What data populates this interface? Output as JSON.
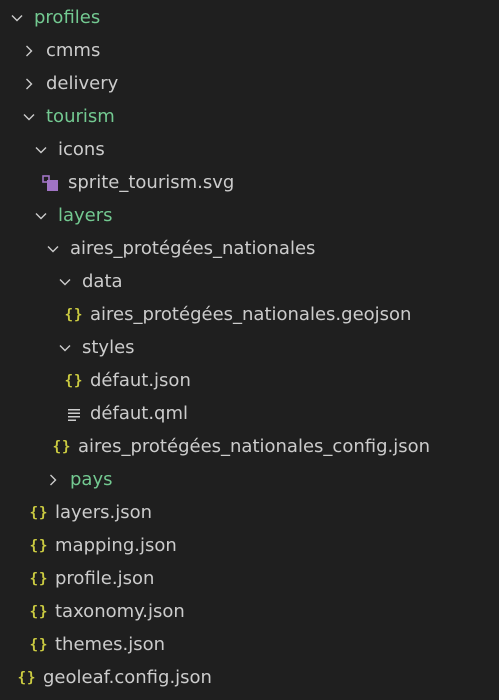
{
  "explorer": {
    "items": [
      {
        "label": "profiles",
        "kind": "folder-open",
        "modified": true
      },
      {
        "label": "cmms",
        "kind": "folder-closed",
        "modified": false
      },
      {
        "label": "delivery",
        "kind": "folder-closed",
        "modified": false
      },
      {
        "label": "tourism",
        "kind": "folder-open",
        "modified": true
      },
      {
        "label": "icons",
        "kind": "folder-open",
        "modified": false
      },
      {
        "label": "sprite_tourism.svg",
        "kind": "svg-file",
        "modified": false
      },
      {
        "label": "layers",
        "kind": "folder-open",
        "modified": true
      },
      {
        "label": "aires_protégées_nationales",
        "kind": "folder-open",
        "modified": false
      },
      {
        "label": "data",
        "kind": "folder-open",
        "modified": false
      },
      {
        "label": "aires_protégées_nationales.geojson",
        "kind": "json-file",
        "modified": false
      },
      {
        "label": "styles",
        "kind": "folder-open",
        "modified": false
      },
      {
        "label": "défaut.json",
        "kind": "json-file",
        "modified": false
      },
      {
        "label": "défaut.qml",
        "kind": "text-file",
        "modified": false
      },
      {
        "label": "aires_protégées_nationales_config.json",
        "kind": "json-file",
        "modified": false
      },
      {
        "label": "pays",
        "kind": "folder-closed",
        "modified": true
      },
      {
        "label": "layers.json",
        "kind": "json-file",
        "modified": false
      },
      {
        "label": "mapping.json",
        "kind": "json-file",
        "modified": false
      },
      {
        "label": "profile.json",
        "kind": "json-file",
        "modified": false
      },
      {
        "label": "taxonomy.json",
        "kind": "json-file",
        "modified": false
      },
      {
        "label": "themes.json",
        "kind": "json-file",
        "modified": false
      },
      {
        "label": "geoleaf.config.json",
        "kind": "json-file",
        "modified": false
      }
    ]
  },
  "colors": {
    "background": "#1f1f1f",
    "text": "#cccccc",
    "modified": "#73c991",
    "json_icon": "#cbcb41",
    "svg_icon": "#a074c4"
  },
  "icons": {
    "json_glyph": "{}"
  }
}
